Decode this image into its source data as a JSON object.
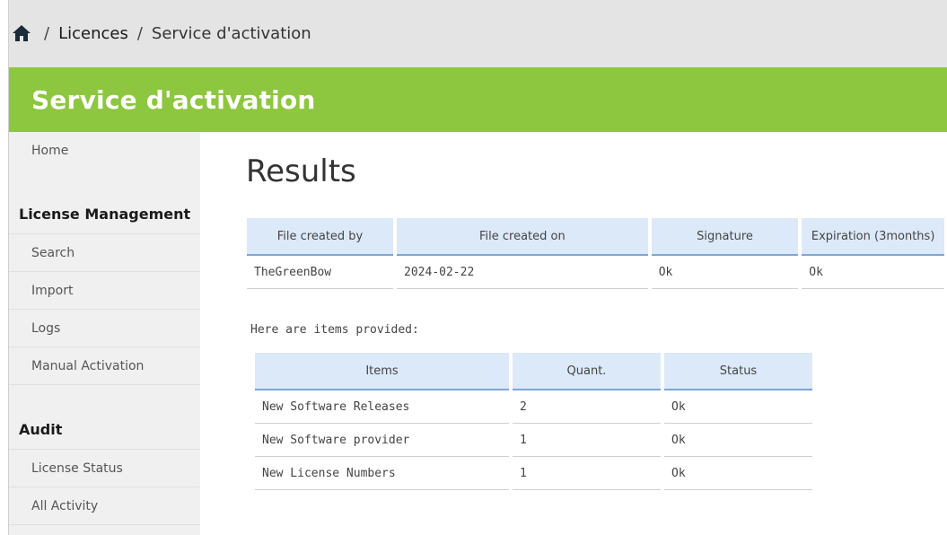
{
  "breadcrumb": {
    "home_icon": "home-icon",
    "sep": "/",
    "licences": "Licences",
    "current": "Service d'activation"
  },
  "banner": {
    "title": "Service d'activation",
    "color": "#8dc63f"
  },
  "sidebar": {
    "home": "Home",
    "license_management": {
      "heading": "License Management",
      "items": [
        "Search",
        "Import",
        "Logs",
        "Manual Activation"
      ]
    },
    "audit": {
      "heading": "Audit",
      "items": [
        "License Status",
        "All Activity"
      ]
    }
  },
  "main": {
    "title": "Results",
    "file_table": {
      "headers": [
        "File created by",
        "File created on",
        "Signature",
        "Expiration (3months)"
      ],
      "row": [
        "TheGreenBow",
        "2024-02-22",
        "Ok",
        "Ok"
      ]
    },
    "items_label": "Here are items provided:",
    "items_table": {
      "headers": [
        "Items",
        "Quant.",
        "Status"
      ],
      "rows": [
        [
          "New Software Releases",
          "2",
          "Ok"
        ],
        [
          "New Software provider",
          "1",
          "Ok"
        ],
        [
          "New License Numbers",
          "1",
          "Ok"
        ]
      ]
    }
  }
}
